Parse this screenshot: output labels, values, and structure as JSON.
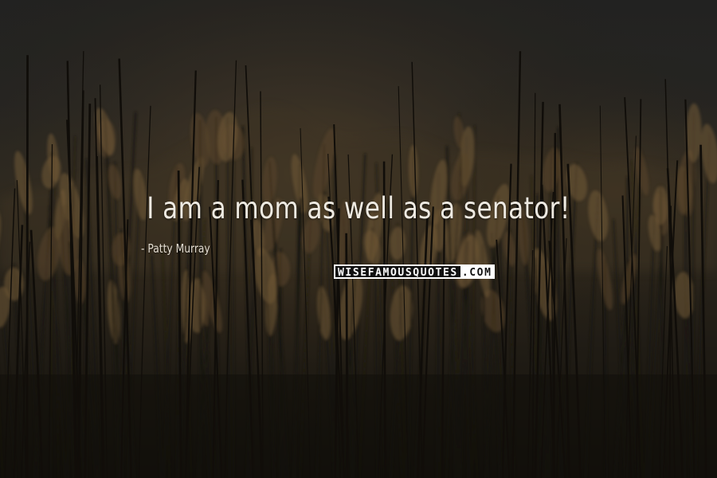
{
  "quote": {
    "text": "I am a mom as well as a senator!",
    "author": "Patty Murray"
  },
  "watermark": {
    "dark_part": "WISEFAMOUSQUOTES",
    "light_part": ".COM"
  },
  "background": {
    "subject": "tall reeds and grass silhouetted at dusk",
    "sky_color": "#2c2c2b",
    "glow_color": "#8a6a3e",
    "foreground_color": "#1b1812"
  }
}
